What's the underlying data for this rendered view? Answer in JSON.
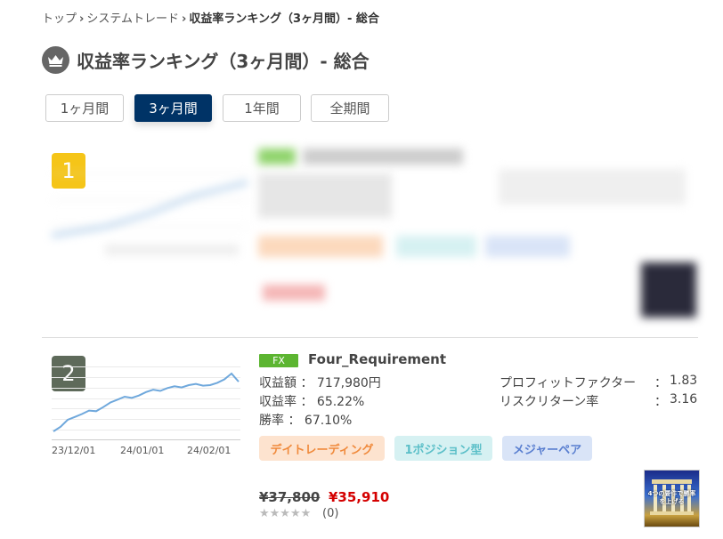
{
  "breadcrumb": {
    "items": [
      "トップ",
      "システムトレード"
    ],
    "separator": "›",
    "current": "収益率ランキング（3ヶ月間）- 総合"
  },
  "header": {
    "title": "収益率ランキング（3ヶ月間）- 総合",
    "icon": "crown-icon"
  },
  "tabs": [
    {
      "label": "1ヶ月間",
      "active": false
    },
    {
      "label": "3ヶ月間",
      "active": true
    },
    {
      "label": "1年間",
      "active": false
    },
    {
      "label": "全期間",
      "active": false
    }
  ],
  "rank1": {
    "rank": "1",
    "color": "#f5c518"
  },
  "rank2": {
    "rank": "2",
    "rank_color": "#5e6a5a",
    "badge": "FX",
    "name": "Four_Requirement",
    "stats_left": [
      {
        "label": "収益額",
        "value": "717,980円"
      },
      {
        "label": "収益率",
        "value": "65.22%"
      },
      {
        "label": "勝率",
        "value": "67.10%"
      }
    ],
    "stats_right": [
      {
        "label": "プロフィットファクター",
        "value": "1.83"
      },
      {
        "label": "リスクリターン率",
        "value": "3.16"
      }
    ],
    "colon": "：",
    "tags": [
      {
        "label": "デイトレーディング",
        "bg": "#fde3cf",
        "fg": "#f08a3c"
      },
      {
        "label": "1ポジション型",
        "bg": "#d6f1f2",
        "fg": "#5bbfc8"
      },
      {
        "label": "メジャーペア",
        "bg": "#d9e4f7",
        "fg": "#5a7fd0"
      }
    ],
    "price_old": "¥37,800",
    "price_new": "¥35,910",
    "stars": "★★★★★",
    "rating": 0,
    "review_count": "(0)",
    "thumb_text": "4つの要件で勝率を上げる"
  },
  "chart_data": {
    "type": "line",
    "x": [
      "23/12/01",
      "24/01/01",
      "24/02/01"
    ],
    "series": [
      {
        "values": [
          0.0,
          0.08,
          0.2,
          0.25,
          0.3,
          0.36,
          0.35,
          0.42,
          0.5,
          0.55,
          0.6,
          0.58,
          0.62,
          0.68,
          0.72,
          0.7,
          0.75,
          0.78,
          0.76,
          0.8,
          0.82,
          0.79,
          0.8,
          0.84,
          0.9,
          1.0,
          0.86
        ]
      }
    ],
    "color": "#6fa8dc",
    "grid": true
  }
}
